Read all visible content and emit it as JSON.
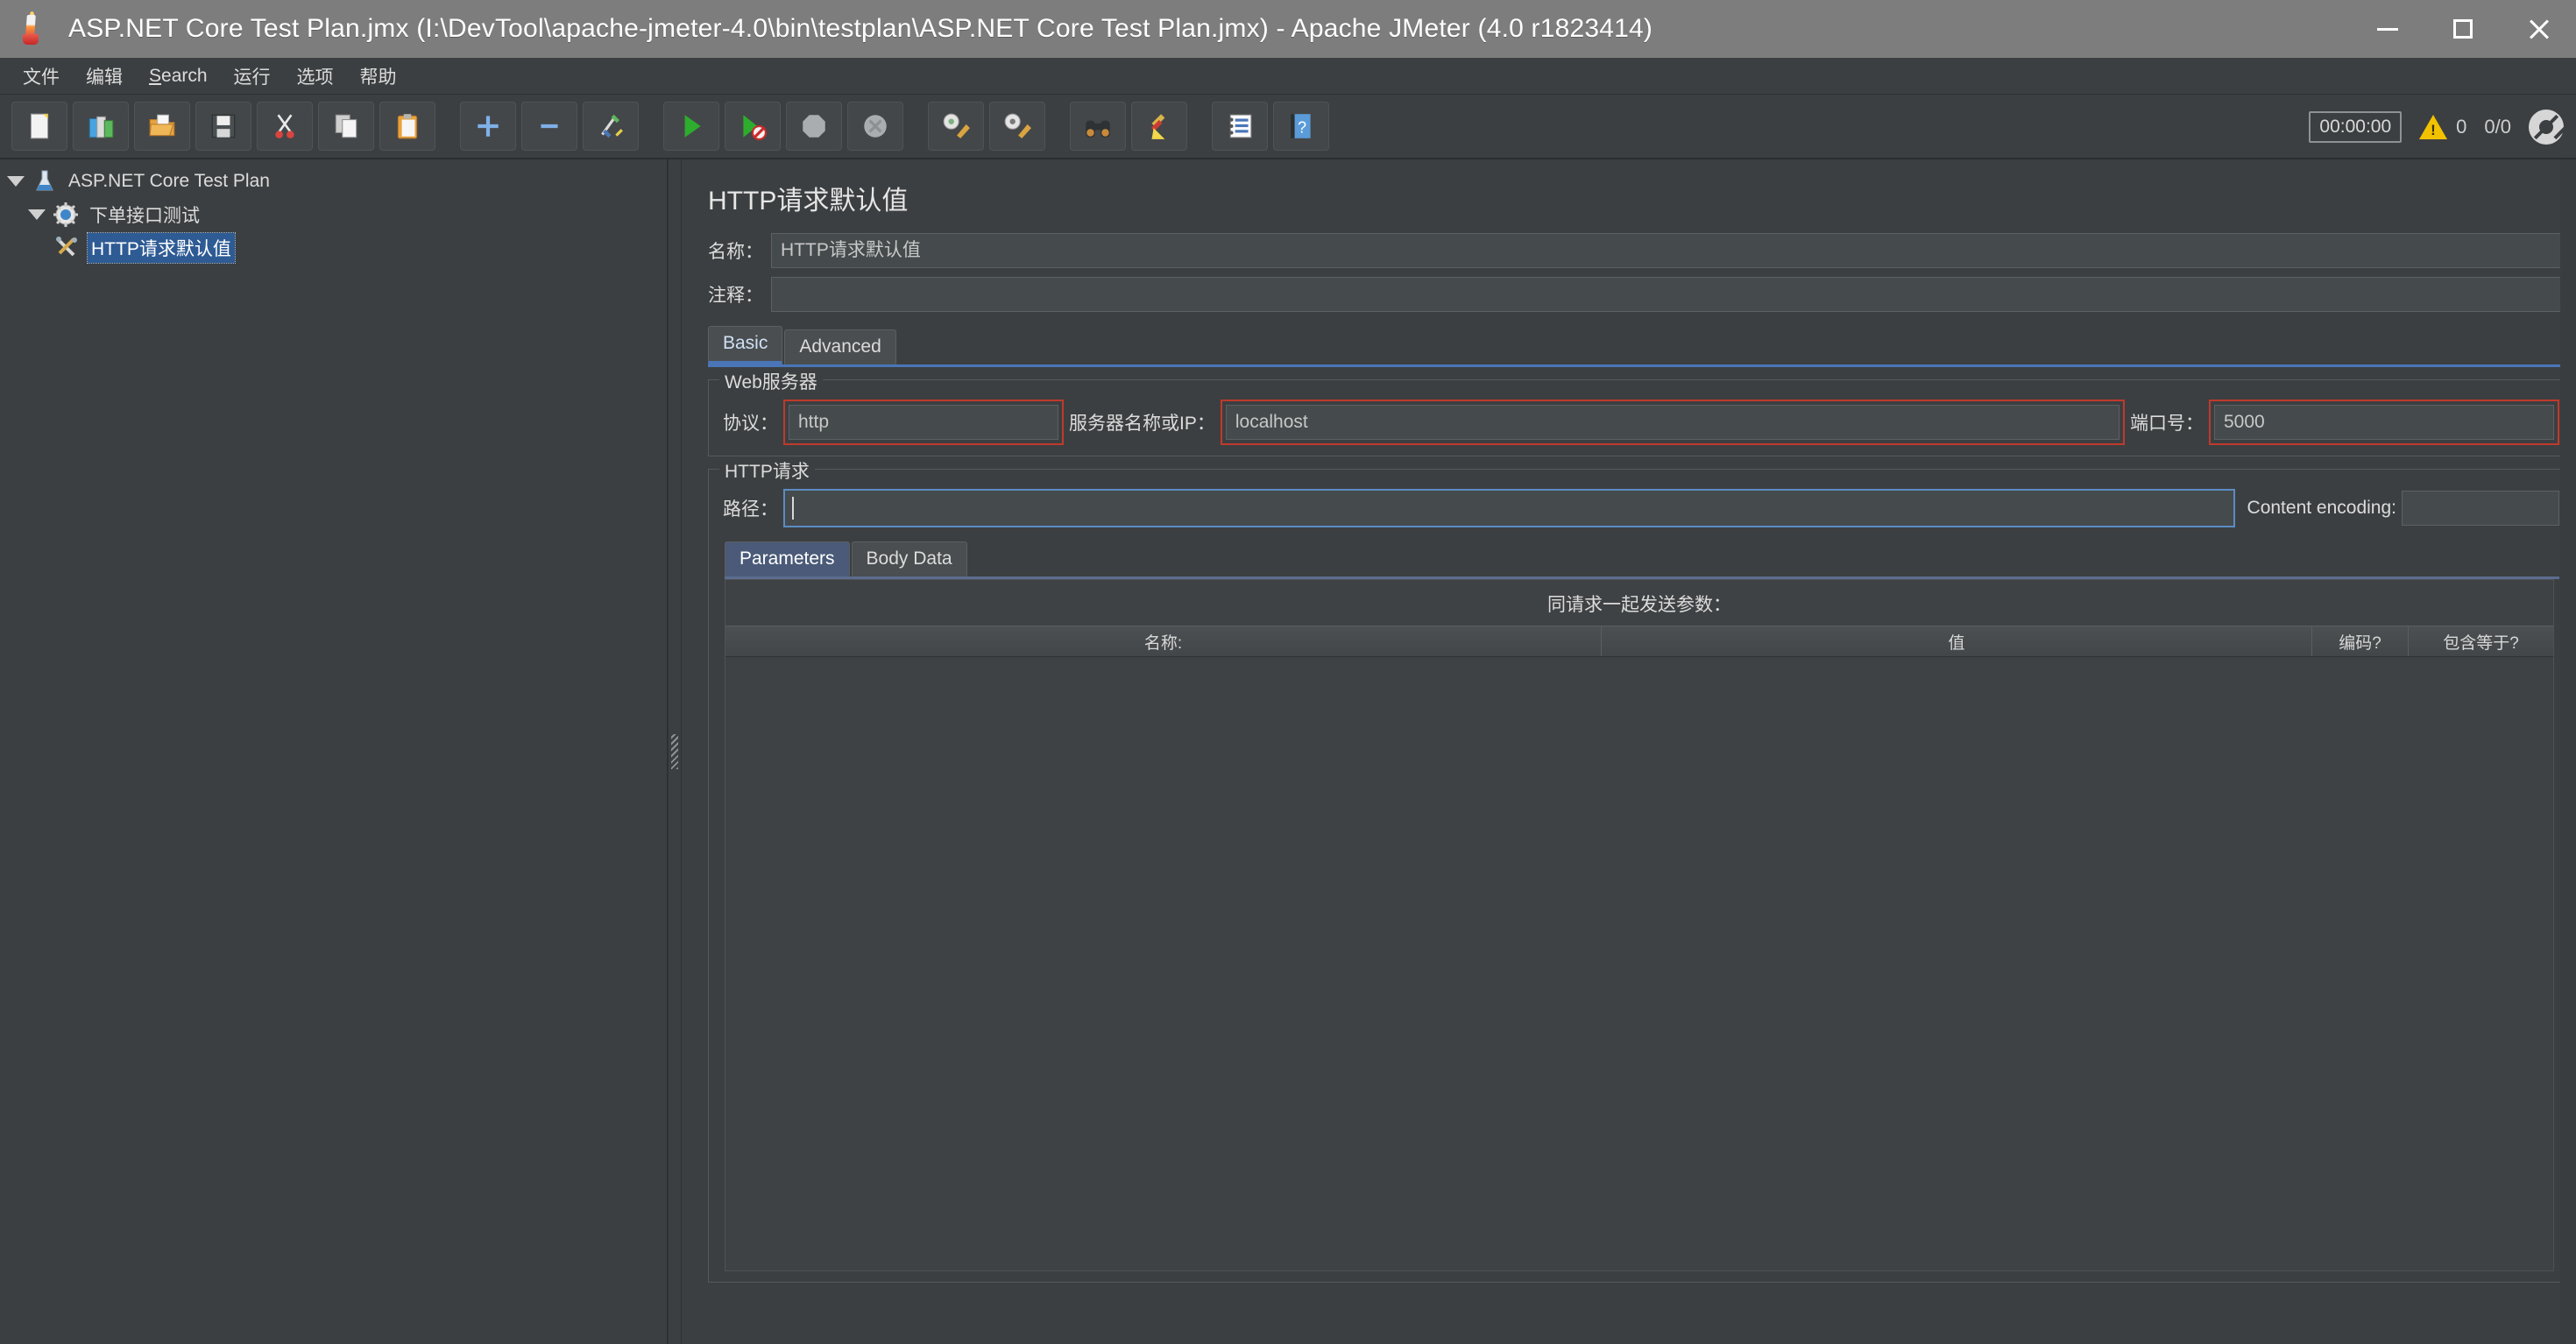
{
  "window": {
    "title": "ASP.NET Core Test Plan.jmx (I:\\DevTool\\apache-jmeter-4.0\\bin\\testplan\\ASP.NET Core Test Plan.jmx) - Apache JMeter (4.0 r1823414)",
    "app_icon": "jmeter-flask-icon",
    "controls": {
      "minimize": "minimize-icon",
      "maximize": "maximize-icon",
      "close": "close-icon"
    }
  },
  "menubar": {
    "items": [
      {
        "label": "文件",
        "name": "menu-file"
      },
      {
        "label": "编辑",
        "name": "menu-edit"
      },
      {
        "label": "Search",
        "name": "menu-search",
        "mnemonic": "S"
      },
      {
        "label": "运行",
        "name": "menu-run"
      },
      {
        "label": "选项",
        "name": "menu-options"
      },
      {
        "label": "帮助",
        "name": "menu-help"
      }
    ]
  },
  "toolbar": {
    "buttons": [
      {
        "name": "new-button",
        "icon": "new-document-icon"
      },
      {
        "name": "templates-button",
        "icon": "templates-icon"
      },
      {
        "name": "open-button",
        "icon": "open-folder-icon"
      },
      {
        "name": "save-button",
        "icon": "save-floppy-icon"
      },
      {
        "name": "cut-button",
        "icon": "scissors-icon"
      },
      {
        "name": "copy-button",
        "icon": "copy-icon"
      },
      {
        "name": "paste-button",
        "icon": "clipboard-paste-icon"
      },
      {
        "name": "expand-button",
        "icon": "plus-icon"
      },
      {
        "name": "collapse-button",
        "icon": "minus-icon"
      },
      {
        "name": "toggle-button",
        "icon": "toggle-icon"
      },
      {
        "name": "start-button",
        "icon": "play-green-icon"
      },
      {
        "name": "start-no-pauses-button",
        "icon": "play-no-pauses-icon"
      },
      {
        "name": "stop-button",
        "icon": "stop-octagon-icon"
      },
      {
        "name": "shutdown-button",
        "icon": "shutdown-icon"
      },
      {
        "name": "clear-button",
        "icon": "clear-gear-broom-icon"
      },
      {
        "name": "clear-all-button",
        "icon": "clear-all-gear-broom-icon"
      },
      {
        "name": "search-button",
        "icon": "binoculars-icon"
      },
      {
        "name": "reset-search-button",
        "icon": "broom-icon"
      },
      {
        "name": "function-helper-button",
        "icon": "notebook-list-icon"
      },
      {
        "name": "help-button",
        "icon": "help-question-icon"
      }
    ],
    "timer": "00:00:00",
    "warning_count": "0",
    "thread_count": "0/0",
    "thread_icon": "active-threads-icon"
  },
  "tree": {
    "nodes": [
      {
        "label": "ASP.NET Core Test Plan",
        "icon": "test-plan-flask-icon",
        "level": 0,
        "expanded": true,
        "selected": false
      },
      {
        "label": "下单接口测试",
        "icon": "thread-group-gear-icon",
        "level": 1,
        "expanded": true,
        "selected": false
      },
      {
        "label": "HTTP请求默认值",
        "icon": "http-defaults-tools-icon",
        "level": 2,
        "expanded": false,
        "selected": true
      }
    ]
  },
  "panel": {
    "title": "HTTP请求默认值",
    "name_label": "名称：",
    "name_value": "HTTP请求默认值",
    "comment_label": "注释：",
    "comment_value": "",
    "tabs": [
      {
        "label": "Basic",
        "active": true
      },
      {
        "label": "Advanced",
        "active": false
      }
    ],
    "web_server": {
      "group_title": "Web服务器",
      "protocol_label": "协议：",
      "protocol_value": "http",
      "server_label": "服务器名称或IP：",
      "server_value": "localhost",
      "port_label": "端口号：",
      "port_value": "5000"
    },
    "http_request": {
      "group_title": "HTTP请求",
      "path_label": "路径：",
      "path_value": "",
      "content_encoding_label": "Content encoding:",
      "content_encoding_value": ""
    },
    "param_tabs": [
      {
        "label": "Parameters",
        "active": true
      },
      {
        "label": "Body Data",
        "active": false
      }
    ],
    "params": {
      "caption": "同请求一起发送参数：",
      "columns": [
        "名称:",
        "值",
        "编码?",
        "包含等于?"
      ],
      "rows": []
    }
  },
  "colors": {
    "background": "#3c3f41",
    "titlebar": "#7d7d7d",
    "accent_blue": "#4a76b8",
    "selection_blue": "#2e5b94",
    "annotation_red": "#c0392b",
    "focus_border": "#5b8cc4"
  }
}
